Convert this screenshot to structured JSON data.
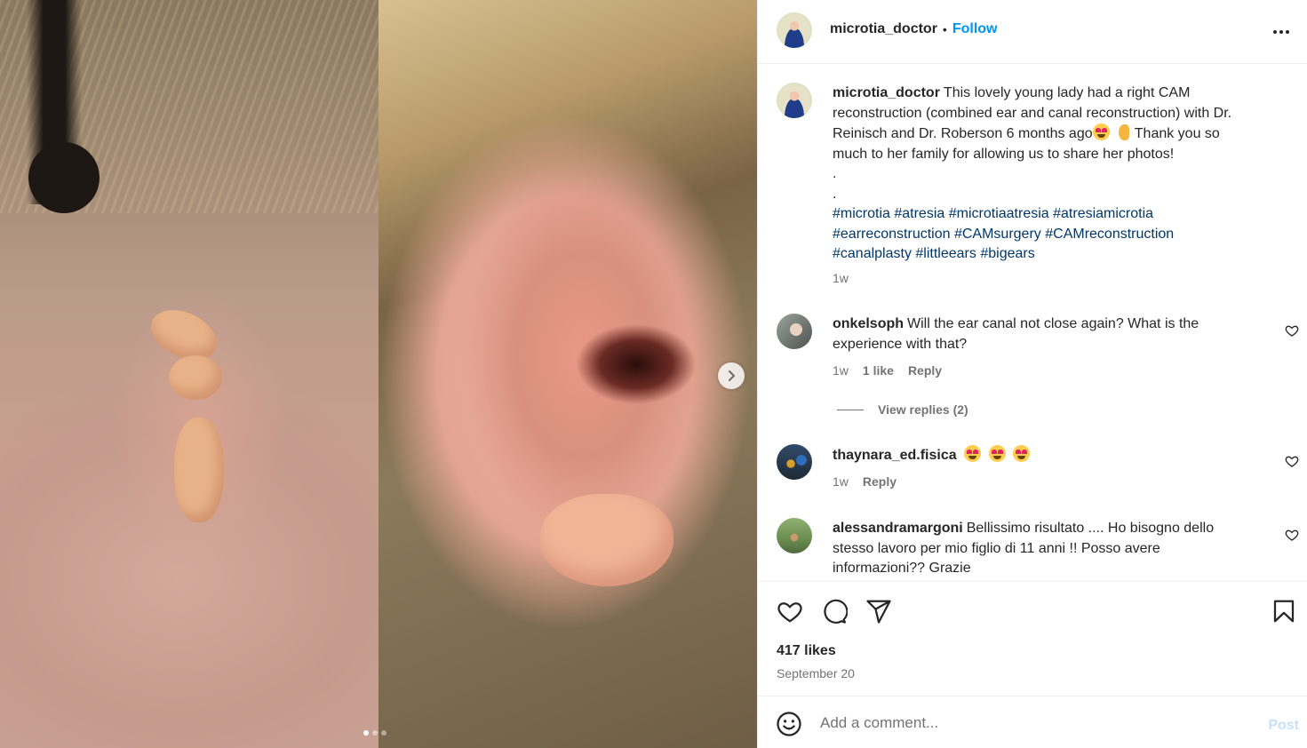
{
  "post": {
    "username": "microtia_doctor",
    "follow_label": "Follow",
    "separator": "•",
    "caption_line1": "This lovely young lady had a right CAM",
    "caption_line2": "reconstruction (combined ear and canal reconstruction) with Dr.",
    "caption_line3_a": "Reinisch and Dr. Roberson 6 months ago",
    "caption_line3_b": "Thank you so",
    "caption_line4": "much to her family for allowing us to share her photos!",
    "dot1": ".",
    "dot2": ".",
    "hashtags_line1": [
      "#microtia",
      "#atresia",
      "#microtiaatresia",
      "#atresiamicrotia"
    ],
    "hashtags_line2": [
      "#earreconstruction",
      "#CAMsurgery",
      "#CAMreconstruction"
    ],
    "hashtags_line3": [
      "#canalplasty",
      "#littleears",
      "#bigears"
    ],
    "time": "1w"
  },
  "carousel": {
    "slides": 3,
    "active": 1
  },
  "comments": [
    {
      "username": "onkelsoph",
      "line1": "Will the ear canal not close again? What is the",
      "line2": "experience with that?",
      "time": "1w",
      "likes": "1 like",
      "reply": "Reply",
      "view_replies": "View replies (2)"
    },
    {
      "username": "thaynara_ed.fisica",
      "time": "1w",
      "reply": "Reply"
    },
    {
      "username": "alessandramargoni",
      "line1": "Bellissimo risultato .... Ho bisogno dello",
      "line2": "stesso lavoro per mio figlio di 11 anni !! Posso avere",
      "line3": "informazioni?? Grazie"
    }
  ],
  "footer": {
    "likes": "417 likes",
    "date": "September 20",
    "comment_placeholder": "Add a comment...",
    "post_label": "Post"
  },
  "colors": {
    "accent": "#0095f6",
    "hashtag": "#00376b",
    "muted": "#737373",
    "post_disabled": "#c7e0f8"
  },
  "icons": [
    "chevron-right-icon",
    "more-icon",
    "heart-icon",
    "comment-icon",
    "share-icon",
    "bookmark-icon",
    "emoji-icon",
    "heart-eyes-emoji",
    "ear-emoji"
  ]
}
